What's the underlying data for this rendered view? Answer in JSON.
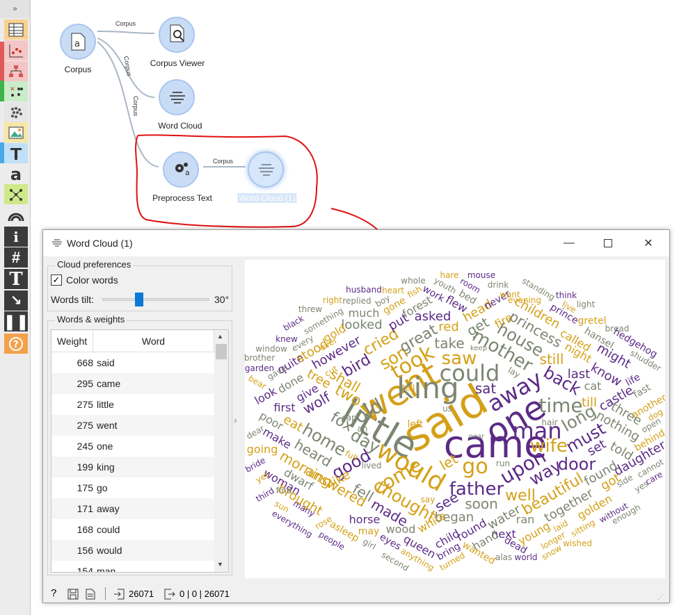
{
  "toolbar": {
    "collapse": "»"
  },
  "canvas": {
    "nodes": {
      "corpus": "Corpus",
      "corpus_viewer": "Corpus Viewer",
      "word_cloud": "Word Cloud",
      "preprocess": "Preprocess Text",
      "word_cloud_1": "Word Cloud (1)"
    },
    "links": [
      "Corpus",
      "Corpus",
      "Corpus",
      "Corpus"
    ]
  },
  "window": {
    "title": "Word Cloud (1)",
    "cloud_prefs": {
      "title": "Cloud preferences",
      "color_words": "Color words",
      "words_tilt_label": "Words tilt:",
      "words_tilt_value": "30°"
    },
    "words_weights": {
      "title": "Words & weights",
      "col_weight": "Weight",
      "col_word": "Word",
      "rows": [
        {
          "w": "668",
          "word": "said"
        },
        {
          "w": "295",
          "word": "came"
        },
        {
          "w": "275",
          "word": "little"
        },
        {
          "w": "275",
          "word": "went"
        },
        {
          "w": "245",
          "word": "one"
        },
        {
          "w": "199",
          "word": "king"
        },
        {
          "w": "175",
          "word": "go"
        },
        {
          "w": "171",
          "word": "away"
        },
        {
          "w": "168",
          "word": "could"
        },
        {
          "w": "156",
          "word": "would"
        },
        {
          "w": "154",
          "word": "man"
        }
      ]
    },
    "status": {
      "input": "26071",
      "output": "0 | 0 | 26071"
    }
  },
  "colors": {
    "purple": "#5b2a86",
    "gold": "#d4a017",
    "gray": "#7c8570"
  },
  "cloud_words": [
    [
      "said",
      62,
      "gold",
      640,
      602,
      -30
    ],
    [
      "came",
      54,
      "purple",
      712,
      640,
      0
    ],
    [
      "little",
      52,
      "gray",
      545,
      618,
      30
    ],
    [
      "went",
      50,
      "gold",
      574,
      564,
      -30
    ],
    [
      "one",
      48,
      "purple",
      741,
      604,
      -30
    ],
    [
      "king",
      42,
      "gray",
      615,
      559,
      0
    ],
    [
      "would",
      36,
      "gold",
      590,
      672,
      30
    ],
    [
      "away",
      32,
      "purple",
      740,
      563,
      -30
    ],
    [
      "could",
      32,
      "gray",
      675,
      537,
      0
    ],
    [
      "man",
      32,
      "purple",
      772,
      620,
      0
    ],
    [
      "go",
      30,
      "gold",
      683,
      672,
      0
    ],
    [
      "took",
      30,
      "gold",
      593,
      522,
      -30
    ],
    [
      "old",
      28,
      "gray",
      530,
      592,
      -30
    ],
    [
      "upon",
      28,
      "purple",
      752,
      672,
      -30
    ],
    [
      "time",
      28,
      "gray",
      806,
      584,
      0
    ],
    [
      "come",
      28,
      "gold",
      571,
      686,
      -30
    ],
    [
      "saw",
      26,
      "gold",
      660,
      516,
      0
    ],
    [
      "father",
      26,
      "purple",
      685,
      704,
      0
    ],
    [
      "mother",
      26,
      "gray",
      722,
      505,
      30
    ],
    [
      "wife",
      26,
      "gold",
      789,
      642,
      0
    ],
    [
      "son",
      24,
      "gold",
      566,
      515,
      -30
    ],
    [
      "day",
      24,
      "gray",
      525,
      635,
      30
    ],
    [
      "home",
      24,
      "gray",
      466,
      633,
      30
    ],
    [
      "house",
      24,
      "gray",
      748,
      489,
      30
    ],
    [
      "thought",
      24,
      "gold",
      584,
      722,
      30
    ],
    [
      "back",
      24,
      "purple",
      808,
      548,
      30
    ],
    [
      "long",
      24,
      "gray",
      832,
      602,
      -30
    ],
    [
      "must",
      24,
      "purple",
      842,
      630,
      -30
    ],
    [
      "good",
      24,
      "purple",
      505,
      668,
      -30
    ],
    [
      "way",
      24,
      "purple",
      784,
      680,
      -30
    ],
    [
      "door",
      24,
      "purple",
      829,
      668,
      0
    ],
    [
      "beautiful",
      22,
      "gold",
      795,
      712,
      -30
    ],
    [
      "fox",
      22,
      "gray",
      491,
      608,
      30
    ],
    [
      "two",
      22,
      "gold",
      500,
      570,
      30
    ],
    [
      "bird",
      22,
      "purple",
      513,
      527,
      -30
    ],
    [
      "cried",
      22,
      "gold",
      548,
      493,
      -30
    ],
    [
      "great",
      22,
      "gray",
      602,
      488,
      -30
    ],
    [
      "well",
      22,
      "gold",
      748,
      714,
      0
    ],
    [
      "take",
      20,
      "gray",
      646,
      494,
      0
    ],
    [
      "shall",
      20,
      "gold",
      496,
      548,
      30
    ],
    [
      "wolf",
      20,
      "purple",
      455,
      580,
      -30
    ],
    [
      "still",
      20,
      "gold",
      793,
      517,
      0
    ],
    [
      "sat",
      20,
      "purple",
      698,
      559,
      0
    ],
    [
      "soon",
      20,
      "gray",
      692,
      725,
      0
    ],
    [
      "fell",
      20,
      "gray",
      522,
      709,
      30
    ],
    [
      "answered",
      20,
      "gold",
      483,
      700,
      30
    ],
    [
      "heard",
      20,
      "gray",
      450,
      652,
      30
    ],
    [
      "morning",
      20,
      "gold",
      440,
      675,
      30
    ],
    [
      "made",
      20,
      "purple",
      560,
      738,
      30
    ],
    [
      "let",
      20,
      "gold",
      645,
      665,
      -30
    ],
    [
      "see",
      20,
      "purple",
      642,
      722,
      -30
    ],
    [
      "princess",
      20,
      "gray",
      770,
      474,
      30
    ],
    [
      "children",
      18,
      "gold",
      772,
      451,
      30
    ],
    [
      "however",
      18,
      "purple",
      484,
      508,
      -30
    ],
    [
      "last",
      18,
      "purple",
      832,
      539,
      0
    ],
    [
      "know",
      18,
      "purple",
      871,
      540,
      30
    ],
    [
      "might",
      18,
      "purple",
      882,
      513,
      30
    ],
    [
      "castle",
      18,
      "purple",
      886,
      574,
      -30
    ],
    [
      "three",
      18,
      "gray",
      900,
      596,
      30
    ],
    [
      "nothing",
      18,
      "gray",
      888,
      614,
      30
    ],
    [
      "set",
      18,
      "purple",
      858,
      645,
      -30
    ],
    [
      "told",
      18,
      "gray",
      893,
      650,
      30
    ],
    [
      "daughter",
      18,
      "purple",
      920,
      660,
      -30
    ],
    [
      "found",
      18,
      "gray",
      864,
      682,
      -30
    ],
    [
      "got",
      18,
      "gold",
      878,
      694,
      -30
    ],
    [
      "together",
      18,
      "gray",
      818,
      728,
      -30
    ],
    [
      "golden",
      16,
      "gold",
      855,
      730,
      -30
    ],
    [
      "began",
      18,
      "gray",
      653,
      745,
      0
    ],
    [
      "water",
      18,
      "gray",
      725,
      745,
      -30
    ],
    [
      "ran",
      16,
      "gray",
      755,
      748,
      0
    ],
    [
      "next",
      16,
      "purple",
      724,
      769,
      0
    ],
    [
      "young",
      16,
      "gold",
      768,
      768,
      -30
    ],
    [
      "horse",
      16,
      "purple",
      524,
      748,
      0
    ],
    [
      "wood",
      16,
      "gray",
      576,
      762,
      0
    ],
    [
      "white",
      16,
      "gold",
      621,
      752,
      -30
    ],
    [
      "round",
      16,
      "purple",
      678,
      763,
      -30
    ],
    [
      "child",
      16,
      "purple",
      643,
      776,
      -30
    ],
    [
      "hand",
      16,
      "gray",
      698,
      778,
      -30
    ],
    [
      "queen",
      16,
      "purple",
      603,
      787,
      30
    ],
    [
      "bring",
      14,
      "purple",
      645,
      794,
      -30
    ],
    [
      "eat",
      18,
      "gold",
      421,
      610,
      30
    ],
    [
      "poor",
      16,
      "gray",
      390,
      606,
      30
    ],
    [
      "first",
      16,
      "purple",
      409,
      587,
      0
    ],
    [
      "look",
      16,
      "purple",
      382,
      570,
      -30
    ],
    [
      "done",
      16,
      "gray",
      418,
      552,
      -30
    ],
    [
      "give",
      16,
      "purple",
      442,
      566,
      -30
    ],
    [
      "tree",
      18,
      "gold",
      458,
      546,
      30
    ],
    [
      "quite",
      16,
      "purple",
      418,
      524,
      -30
    ],
    [
      "stood",
      18,
      "gold",
      449,
      506,
      -30
    ],
    [
      "make",
      16,
      "purple",
      398,
      631,
      30
    ],
    [
      "going",
      16,
      "gold",
      377,
      647,
      0
    ],
    [
      "dwarf",
      16,
      "gray",
      429,
      690,
      30
    ],
    [
      "woman",
      16,
      "purple",
      405,
      694,
      30
    ],
    [
      "brought",
      18,
      "gold",
      431,
      720,
      30
    ],
    [
      "like",
      18,
      "gold",
      489,
      690,
      -30
    ],
    [
      "looked",
      18,
      "gray",
      520,
      468,
      0
    ],
    [
      "put",
      18,
      "purple",
      573,
      464,
      -30
    ],
    [
      "forest",
      16,
      "gray",
      600,
      442,
      -30
    ],
    [
      "asked",
      18,
      "purple",
      622,
      456,
      0
    ],
    [
      "red",
      18,
      "gold",
      645,
      471,
      0
    ],
    [
      "get",
      20,
      "gray",
      687,
      470,
      -30
    ],
    [
      "head",
      18,
      "gold",
      687,
      448,
      -30
    ],
    [
      "fire",
      16,
      "gold",
      724,
      462,
      -30
    ],
    [
      "much",
      16,
      "gray",
      523,
      451,
      0
    ],
    [
      "called",
      16,
      "gold",
      827,
      490,
      30
    ],
    [
      "night",
      16,
      "gold",
      831,
      508,
      30
    ],
    [
      "cat",
      16,
      "gray",
      852,
      556,
      0
    ],
    [
      "till",
      18,
      "gold",
      847,
      580,
      0
    ],
    [
      "gold",
      16,
      "gold",
      481,
      480,
      -30
    ],
    [
      "prince",
      14,
      "purple",
      811,
      452,
      30
    ],
    [
      "hansel",
      14,
      "gray",
      861,
      487,
      30
    ],
    [
      "gretel",
      14,
      "gold",
      851,
      462,
      0
    ],
    [
      "hedgehog",
      14,
      "purple",
      913,
      494,
      30
    ],
    [
      "life",
      14,
      "purple",
      910,
      547,
      -30
    ],
    [
      "another",
      14,
      "gold",
      933,
      585,
      -30
    ],
    [
      "fast",
      14,
      "gray",
      923,
      563,
      -30
    ],
    [
      "shudder",
      12,
      "gray",
      928,
      519,
      30
    ],
    [
      "bread",
      12,
      "gray",
      887,
      473,
      0
    ],
    [
      "dog",
      12,
      "gold",
      942,
      597,
      -30
    ],
    [
      "open",
      12,
      "gray",
      936,
      612,
      -30
    ],
    [
      "behind",
      14,
      "gold",
      934,
      634,
      -30
    ],
    [
      "cannot",
      12,
      "gray",
      935,
      674,
      -30
    ],
    [
      "care",
      12,
      "purple",
      940,
      688,
      -30
    ],
    [
      "yes",
      12,
      "gray",
      922,
      700,
      -30
    ],
    [
      "side",
      12,
      "gray",
      898,
      692,
      -30
    ],
    [
      "without",
      12,
      "purple",
      882,
      738,
      -30
    ],
    [
      "enough",
      12,
      "gray",
      900,
      740,
      -30
    ],
    [
      "sitting",
      12,
      "gold",
      838,
      760,
      -30
    ],
    [
      "laid",
      12,
      "gold",
      806,
      757,
      -30
    ],
    [
      "longer",
      12,
      "gold",
      795,
      778,
      -30
    ],
    [
      "wished",
      12,
      "gold",
      830,
      782,
      0
    ],
    [
      "snow",
      12,
      "gold",
      793,
      795,
      -30
    ],
    [
      "world",
      12,
      "purple",
      756,
      802,
      0
    ],
    [
      "dead",
      14,
      "purple",
      741,
      785,
      30
    ],
    [
      "alas",
      12,
      "gray",
      724,
      802,
      0
    ],
    [
      "wanted",
      14,
      "gold",
      688,
      796,
      30
    ],
    [
      "turned",
      12,
      "gold",
      650,
      808,
      -30
    ],
    [
      "anything",
      12,
      "gold",
      600,
      805,
      30
    ],
    [
      "second",
      12,
      "gray",
      568,
      808,
      30
    ],
    [
      "eyes",
      14,
      "purple",
      561,
      780,
      30
    ],
    [
      "girl",
      12,
      "gray",
      531,
      783,
      30
    ],
    [
      "may",
      14,
      "gold",
      530,
      765,
      0
    ],
    [
      "asleep",
      14,
      "gold",
      495,
      765,
      30
    ],
    [
      "people",
      12,
      "purple",
      477,
      778,
      30
    ],
    [
      "rose",
      12,
      "gold",
      465,
      752,
      -30
    ],
    [
      "many",
      12,
      "purple",
      437,
      732,
      30
    ],
    [
      "everything",
      12,
      "purple",
      420,
      754,
      30
    ],
    [
      "sun",
      12,
      "gold",
      405,
      729,
      30
    ],
    [
      "third",
      12,
      "purple",
      381,
      712,
      -30
    ],
    [
      "find",
      12,
      "gray",
      408,
      706,
      0
    ],
    [
      "yet",
      12,
      "gold",
      377,
      687,
      -30
    ],
    [
      "bride",
      12,
      "purple",
      367,
      669,
      -30
    ],
    [
      "dear",
      12,
      "gray",
      367,
      622,
      -30
    ],
    [
      "bear",
      12,
      "gold",
      370,
      550,
      30
    ],
    [
      "gave",
      12,
      "gray",
      398,
      536,
      -30
    ],
    [
      "garden",
      12,
      "purple",
      373,
      530,
      0
    ],
    [
      "brother",
      12,
      "gray",
      373,
      515,
      0
    ],
    [
      "window",
      12,
      "gray",
      390,
      502,
      0
    ],
    [
      "knew",
      12,
      "purple",
      412,
      488,
      0
    ],
    [
      "every",
      12,
      "gray",
      435,
      494,
      -30
    ],
    [
      "black",
      12,
      "purple",
      422,
      465,
      -30
    ],
    [
      "something",
      12,
      "gray",
      465,
      462,
      -30
    ],
    [
      "threw",
      12,
      "gray",
      446,
      445,
      0
    ],
    [
      "right",
      12,
      "gold",
      478,
      432,
      0
    ],
    [
      "replied",
      12,
      "gray",
      513,
      433,
      0
    ],
    [
      "husband",
      12,
      "purple",
      523,
      417,
      0
    ],
    [
      "boy",
      12,
      "gray",
      550,
      433,
      -30
    ],
    [
      "gone",
      14,
      "gold",
      567,
      440,
      -30
    ],
    [
      "heart",
      12,
      "gold",
      565,
      418,
      0
    ],
    [
      "fish",
      12,
      "gold",
      596,
      420,
      -30
    ],
    [
      "whole",
      12,
      "gray",
      594,
      404,
      0
    ],
    [
      "youth",
      12,
      "gray",
      640,
      411,
      30
    ],
    [
      "work",
      14,
      "purple",
      623,
      423,
      30
    ],
    [
      "flew",
      16,
      "purple",
      656,
      438,
      30
    ],
    [
      "hare",
      12,
      "gold",
      646,
      396,
      0
    ],
    [
      "room",
      12,
      "purple",
      676,
      411,
      30
    ],
    [
      "bed",
      14,
      "gray",
      672,
      428,
      30
    ],
    [
      "mouse",
      12,
      "purple",
      692,
      396,
      0
    ],
    [
      "drink",
      12,
      "gray",
      716,
      410,
      0
    ],
    [
      "never",
      14,
      "purple",
      715,
      432,
      -30
    ],
    [
      "want",
      12,
      "gold",
      733,
      424,
      0
    ],
    [
      "evening",
      12,
      "gold",
      754,
      432,
      0
    ],
    [
      "standing",
      12,
      "gray",
      774,
      416,
      30
    ],
    [
      "think",
      12,
      "purple",
      814,
      425,
      0
    ],
    [
      "live",
      12,
      "gold",
      818,
      442,
      30
    ],
    [
      "light",
      12,
      "gray",
      842,
      438,
      0
    ],
    [
      "keep",
      10,
      "gray",
      688,
      502,
      0
    ],
    [
      "lay",
      12,
      "gray",
      739,
      536,
      30
    ],
    [
      "hair",
      12,
      "gray",
      790,
      608,
      0
    ],
    [
      "run",
      12,
      "gray",
      723,
      667,
      0
    ],
    [
      "near",
      10,
      "gray",
      685,
      629,
      0
    ],
    [
      "us",
      12,
      "gray",
      643,
      588,
      0
    ],
    [
      "tell",
      12,
      "gold",
      587,
      558,
      0
    ],
    [
      "cap",
      12,
      "gray",
      502,
      601,
      0
    ],
    [
      "ah",
      12,
      "gray",
      521,
      617,
      0
    ],
    [
      "left",
      14,
      "gold",
      597,
      611,
      0
    ],
    [
      "full",
      12,
      "gold",
      505,
      656,
      30
    ],
    [
      "lived",
      12,
      "gray",
      534,
      670,
      0
    ],
    [
      "say",
      12,
      "gold",
      615,
      719,
      0
    ],
    [
      "cut",
      12,
      "gold",
      476,
      534,
      -30
    ],
    [
      "ever",
      12,
      "gold",
      472,
      495,
      -30
    ]
  ]
}
